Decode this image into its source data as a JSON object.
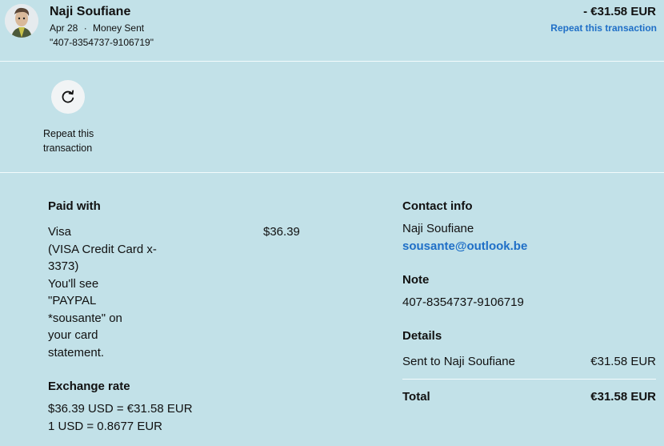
{
  "header": {
    "name": "Naji Soufiane",
    "date": "Apr 28",
    "separator": "·",
    "type": "Money Sent",
    "memo": "\"407-8354737-9106719\"",
    "amount": "- €31.58 EUR",
    "repeat_link": "Repeat this transaction"
  },
  "repeat_action": {
    "label": "Repeat this transaction",
    "icon": "refresh-icon"
  },
  "paid_with": {
    "title": "Paid with",
    "card_lines": [
      "Visa",
      "(VISA Credit Card x-",
      "3373)",
      "You'll see",
      "\"PAYPAL",
      "*sousante\" on",
      "your card",
      "statement."
    ],
    "amount": "$36.39"
  },
  "exchange": {
    "title": "Exchange rate",
    "line1": "$36.39 USD = €31.58 EUR",
    "line2": "1 USD = 0.8677 EUR"
  },
  "contact": {
    "title": "Contact info",
    "name": "Naji Soufiane",
    "email": "sousante@outlook.be"
  },
  "note": {
    "title": "Note",
    "value": "407-8354737-9106719"
  },
  "details": {
    "title": "Details",
    "sent_label": "Sent to Naji Soufiane",
    "sent_amount": "€31.58 EUR",
    "total_label": "Total",
    "total_amount": "€31.58 EUR"
  },
  "colors": {
    "background": "#c2e1e8",
    "link": "#1f6fc7"
  }
}
